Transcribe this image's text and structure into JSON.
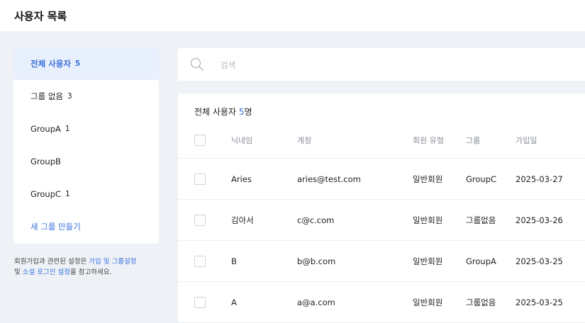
{
  "page": {
    "title": "사용자 목록"
  },
  "sidebar": {
    "groups": [
      {
        "label": "전체 사용자",
        "count": "5"
      },
      {
        "label": "그룹 없음",
        "count": "3"
      },
      {
        "label": "GroupA",
        "count": "1"
      },
      {
        "label": "GroupB",
        "count": ""
      },
      {
        "label": "GroupC",
        "count": "1"
      }
    ],
    "create_label": "새 그룹 만들기"
  },
  "help": {
    "prefix": "회원가입과 관련된 설정은 ",
    "link1": "가입 및 그룹설정",
    "line2_prefix": "및 ",
    "link2": "소셜 로그인 설정",
    "suffix": "을 참고하세요."
  },
  "search": {
    "placeholder": "검색",
    "value": ""
  },
  "table": {
    "heading_prefix": "전체 사용자 ",
    "heading_count": "5",
    "heading_suffix": "명",
    "columns": {
      "nickname": "닉네임",
      "account": "계정",
      "type": "회원 유형",
      "group": "그룹",
      "joined": "가입일"
    },
    "rows": [
      {
        "nickname": "Aries",
        "account": "aries@test.com",
        "type": "일반회원",
        "group": "GroupC",
        "joined": "2025-03-27"
      },
      {
        "nickname": "김아서",
        "account": "c@c.com",
        "type": "일반회원",
        "group": "그룹없음",
        "joined": "2025-03-26"
      },
      {
        "nickname": "B",
        "account": "b@b.com",
        "type": "일반회원",
        "group": "GroupA",
        "joined": "2025-03-25"
      },
      {
        "nickname": "A",
        "account": "a@a.com",
        "type": "일반회원",
        "group": "그룹없음",
        "joined": "2025-03-25"
      }
    ]
  },
  "colors": {
    "accent": "#3a72e0",
    "active_bg": "#e9f0fd",
    "page_bg": "#eef1f6"
  }
}
